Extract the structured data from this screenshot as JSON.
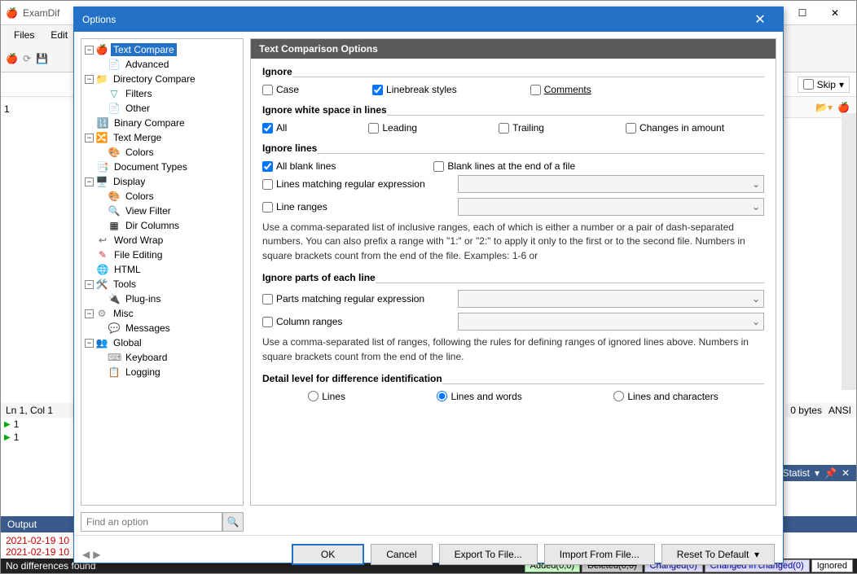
{
  "main": {
    "title": "ExamDif",
    "menus": [
      "Files",
      "Edit"
    ],
    "skip_label": "Skip",
    "left_line1": "1",
    "status_left": "Ln 1, Col 1",
    "diff1": "1",
    "diff2": "1",
    "right_bytes": "0 bytes",
    "right_enc": "ANSI",
    "output_title": "Output",
    "output_line1": "2021-02-19 10",
    "output_line2": "2021-02-19 10",
    "statbar_nodiff": "No differences found",
    "stat_added": "Added(0,0)",
    "stat_deleted": "Deleted(0,0)",
    "stat_changed": "Changed(0)",
    "stat_chinch": "Changed in changed(0)",
    "stat_ignored": "Ignored",
    "statist": "Statist"
  },
  "dlg": {
    "title": "Options",
    "header": "Text Comparison Options",
    "tree": {
      "text_compare": "Text Compare",
      "advanced": "Advanced",
      "dir_compare": "Directory Compare",
      "filters": "Filters",
      "other": "Other",
      "binary": "Binary Compare",
      "merge": "Text Merge",
      "colors": "Colors",
      "doctypes": "Document Types",
      "display": "Display",
      "viewfilter": "View Filter",
      "dircols": "Dir Columns",
      "wordwrap": "Word Wrap",
      "fileedit": "File Editing",
      "html": "HTML",
      "tools": "Tools",
      "plugins": "Plug-ins",
      "misc": "Misc",
      "messages": "Messages",
      "global": "Global",
      "keyboard": "Keyboard",
      "logging": "Logging"
    },
    "sec_ignore": "Ignore",
    "cb_case": "Case",
    "cb_linebreak": "Linebreak styles",
    "cb_comments": "Comments",
    "sec_white": "Ignore white space in lines",
    "cb_all": "All",
    "cb_leading": "Leading",
    "cb_trailing": "Trailing",
    "cb_changes": "Changes in amount",
    "sec_lines": "Ignore lines",
    "cb_blank": "All blank lines",
    "cb_blankend": "Blank lines at the end of a file",
    "cb_regex_lines": "Lines matching regular expression",
    "cb_lineranges": "Line ranges",
    "hint1": "Use a comma-separated list of inclusive ranges, each of which is either a number or a pair of dash-separated numbers. You can also prefix a range with \"1:\" or \"2:\" to apply it only to the first or to the second file. Numbers in square brackets count from the end of the file. Examples: 1-6 or",
    "sec_parts": "Ignore parts of each line",
    "cb_regex_parts": "Parts matching regular expression",
    "cb_colranges": "Column ranges",
    "hint2": "Use a comma-separated list of ranges, following the rules for defining ranges of ignored lines above. Numbers in square brackets count from the end of the line.",
    "sec_detail": "Detail level for difference identification",
    "r_lines": "Lines",
    "r_linewords": "Lines and words",
    "r_linechars": "Lines and characters",
    "search_placeholder": "Find an option",
    "btn_ok": "OK",
    "btn_cancel": "Cancel",
    "btn_export": "Export To File...",
    "btn_import": "Import From File...",
    "btn_reset": "Reset To Default"
  }
}
